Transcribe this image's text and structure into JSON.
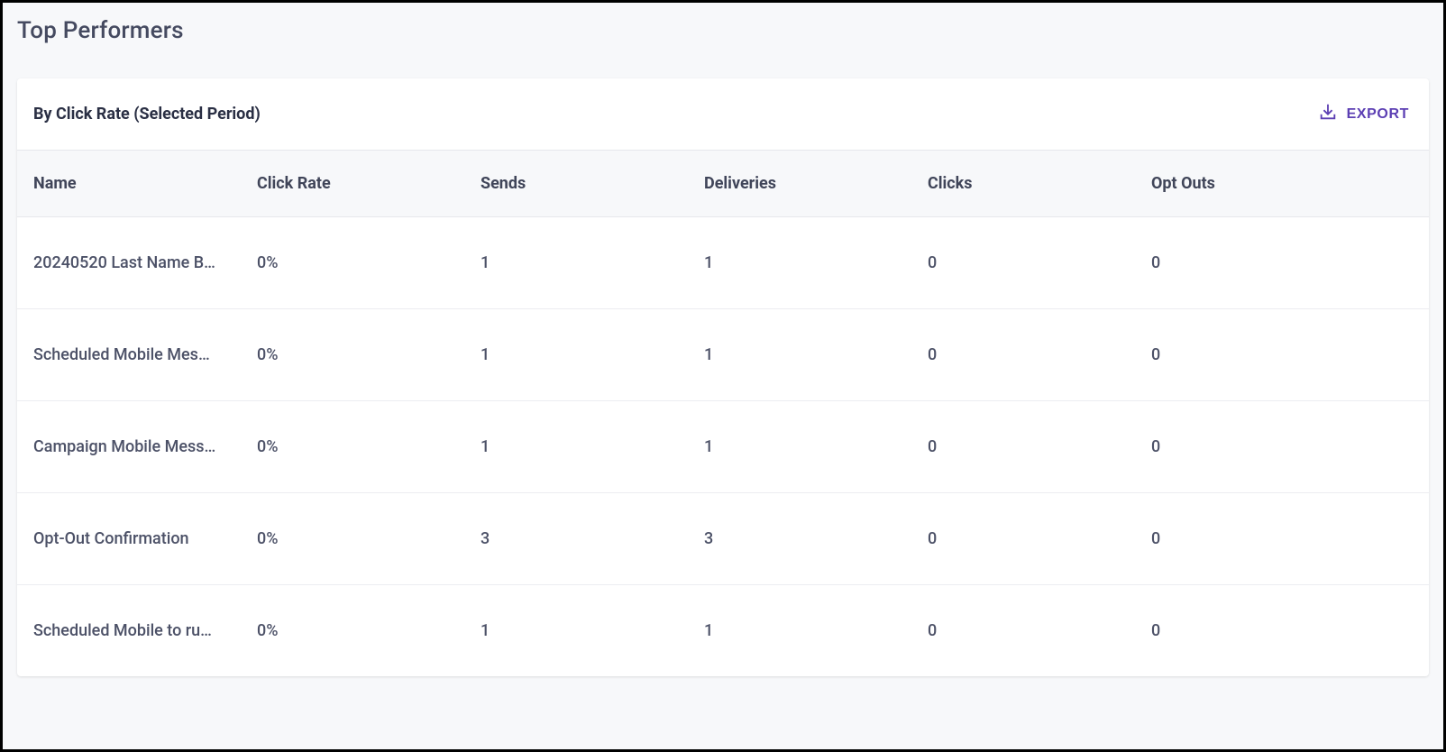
{
  "page": {
    "title": "Top Performers"
  },
  "card": {
    "subtitle": "By Click Rate (Selected Period)",
    "export_label": "EXPORT"
  },
  "table": {
    "columns": {
      "name": "Name",
      "click_rate": "Click Rate",
      "sends": "Sends",
      "deliveries": "Deliveries",
      "clicks": "Clicks",
      "opt_outs": "Opt Outs"
    },
    "rows": [
      {
        "name": "20240520 Last Name B…",
        "click_rate": "0%",
        "sends": "1",
        "deliveries": "1",
        "clicks": "0",
        "opt_outs": "0"
      },
      {
        "name": "Scheduled Mobile Mes…",
        "click_rate": "0%",
        "sends": "1",
        "deliveries": "1",
        "clicks": "0",
        "opt_outs": "0"
      },
      {
        "name": "Campaign Mobile Mess…",
        "click_rate": "0%",
        "sends": "1",
        "deliveries": "1",
        "clicks": "0",
        "opt_outs": "0"
      },
      {
        "name": "Opt-Out Confirmation",
        "click_rate": "0%",
        "sends": "3",
        "deliveries": "3",
        "clicks": "0",
        "opt_outs": "0"
      },
      {
        "name": "Scheduled Mobile to ru…",
        "click_rate": "0%",
        "sends": "1",
        "deliveries": "1",
        "clicks": "0",
        "opt_outs": "0"
      }
    ]
  }
}
